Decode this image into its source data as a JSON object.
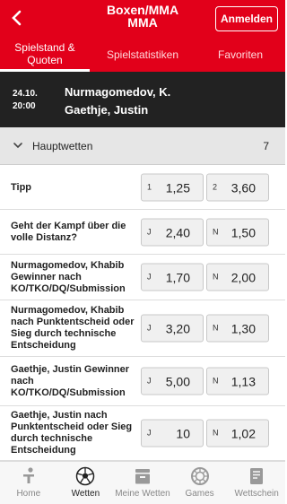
{
  "header": {
    "title_line1": "Boxen/MMA",
    "title_line2": "MMA",
    "login_label": "Anmelden",
    "tabs": [
      {
        "line1": "Spielstand &",
        "line2": "Quoten"
      },
      {
        "line1": "Spielstatistiken",
        "line2": ""
      },
      {
        "line1": "Favoriten",
        "line2": ""
      }
    ]
  },
  "event": {
    "date": "24.10.",
    "time": "20:00",
    "team1": "Nurmagomedov, K.",
    "team2": "Gaethje, Justin"
  },
  "section": {
    "title": "Hauptwetten",
    "count": "7"
  },
  "bets": [
    {
      "label": "Tipp",
      "odds": [
        {
          "key": "1",
          "value": "1,25"
        },
        {
          "key": "2",
          "value": "3,60"
        }
      ]
    },
    {
      "label": "Geht der Kampf über die volle Distanz?",
      "odds": [
        {
          "key": "J",
          "value": "2,40"
        },
        {
          "key": "N",
          "value": "1,50"
        }
      ]
    },
    {
      "label": "Nurmagomedov, Khabib Gewinner nach KO/TKO/DQ/Submission",
      "odds": [
        {
          "key": "J",
          "value": "1,70"
        },
        {
          "key": "N",
          "value": "2,00"
        }
      ]
    },
    {
      "label": "Nurmagomedov, Khabib nach Punktentscheid oder Sieg durch technische Entscheidung",
      "odds": [
        {
          "key": "J",
          "value": "3,20"
        },
        {
          "key": "N",
          "value": "1,30"
        }
      ]
    },
    {
      "label": "Gaethje, Justin Gewinner nach KO/TKO/DQ/Submission",
      "odds": [
        {
          "key": "J",
          "value": "5,00"
        },
        {
          "key": "N",
          "value": "1,13"
        }
      ]
    },
    {
      "label": "Gaethje, Justin nach Punktentscheid oder Sieg durch technische Entscheidung",
      "odds": [
        {
          "key": "J",
          "value": "10"
        },
        {
          "key": "N",
          "value": "1,02"
        }
      ]
    }
  ],
  "bottom_nav": [
    {
      "label": "Home",
      "icon": "home-icon"
    },
    {
      "label": "Wetten",
      "icon": "football-icon"
    },
    {
      "label": "Meine Wetten",
      "icon": "bets-icon"
    },
    {
      "label": "Games",
      "icon": "games-icon"
    },
    {
      "label": "Wettschein",
      "icon": "betslip-icon"
    }
  ],
  "colors": {
    "brand": "#e2001a",
    "event_bg": "#222222"
  }
}
